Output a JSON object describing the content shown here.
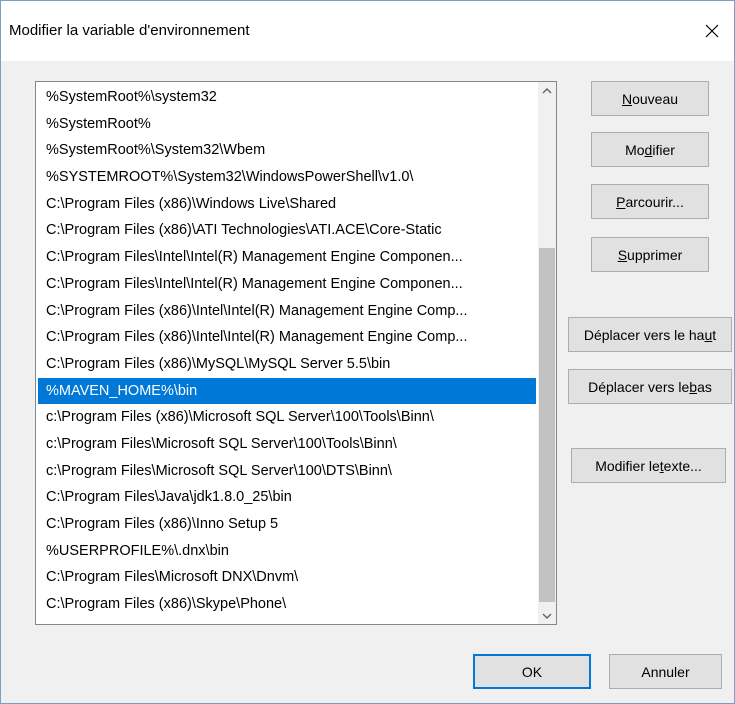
{
  "dialog": {
    "title": "Modifier la variable d'environnement"
  },
  "list": {
    "items": [
      "%SystemRoot%\\system32",
      "%SystemRoot%",
      "%SystemRoot%\\System32\\Wbem",
      "%SYSTEMROOT%\\System32\\WindowsPowerShell\\v1.0\\",
      "C:\\Program Files (x86)\\Windows Live\\Shared",
      "C:\\Program Files (x86)\\ATI Technologies\\ATI.ACE\\Core-Static",
      "C:\\Program Files\\Intel\\Intel(R) Management Engine Componen...",
      "C:\\Program Files\\Intel\\Intel(R) Management Engine Componen...",
      "C:\\Program Files (x86)\\Intel\\Intel(R) Management Engine Comp...",
      "C:\\Program Files (x86)\\Intel\\Intel(R) Management Engine Comp...",
      "C:\\Program Files (x86)\\MySQL\\MySQL Server 5.5\\bin",
      "%MAVEN_HOME%\\bin",
      "c:\\Program Files (x86)\\Microsoft SQL Server\\100\\Tools\\Binn\\",
      "c:\\Program Files\\Microsoft SQL Server\\100\\Tools\\Binn\\",
      "c:\\Program Files\\Microsoft SQL Server\\100\\DTS\\Binn\\",
      "C:\\Program Files\\Java\\jdk1.8.0_25\\bin",
      "C:\\Program Files (x86)\\Inno Setup 5",
      "%USERPROFILE%\\.dnx\\bin",
      "C:\\Program Files\\Microsoft DNX\\Dnvm\\",
      "C:\\Program Files (x86)\\Skype\\Phone\\"
    ],
    "selected_index": 11
  },
  "buttons": {
    "new": {
      "pre": "",
      "key": "N",
      "post": "ouveau"
    },
    "edit": {
      "pre": "Mo",
      "key": "d",
      "post": "ifier"
    },
    "browse": {
      "pre": "",
      "key": "P",
      "post": "arcourir..."
    },
    "delete": {
      "pre": "",
      "key": "S",
      "post": "upprimer"
    },
    "move_up": {
      "pre": "Déplacer vers le ha",
      "key": "u",
      "post": "t"
    },
    "move_down": {
      "pre": "Déplacer vers le ",
      "key": "b",
      "post": "as"
    },
    "edit_text": {
      "pre": "Modifier le ",
      "key": "t",
      "post": "exte..."
    },
    "ok": "OK",
    "cancel": "Annuler"
  },
  "icons": {
    "close": "close-icon",
    "scroll_up": "chevron-up-icon",
    "scroll_down": "chevron-down-icon"
  },
  "colors": {
    "selection": "#0078d7",
    "default_button_border": "#0078d7"
  }
}
